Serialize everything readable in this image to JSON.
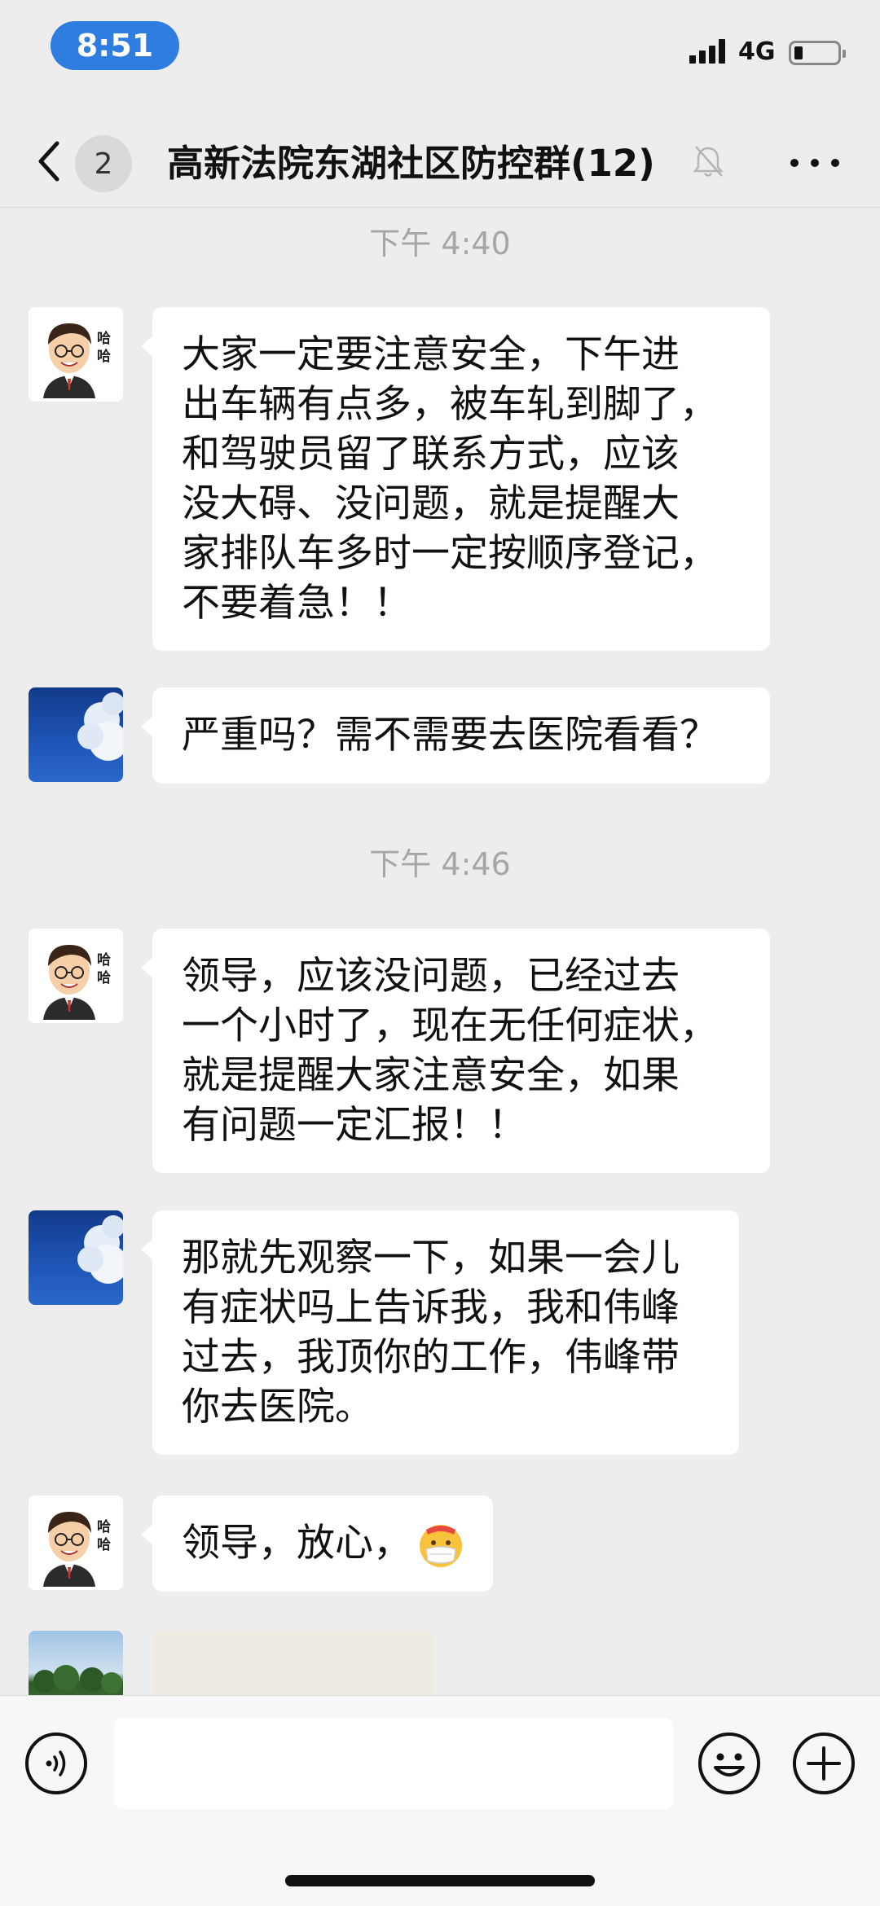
{
  "status_bar": {
    "time": "8:51",
    "network": "4G",
    "battery_level": 0.2
  },
  "nav": {
    "unread_count": "2",
    "title": "高新法院东湖社区防控群(12)",
    "icons": {
      "back": "chevron-left-icon",
      "mute": "bell-off-icon",
      "more": "more-dots-icon"
    }
  },
  "chat": {
    "timestamps": [
      "下午 4:40",
      "下午 4:46"
    ],
    "messages": [
      {
        "sender_avatar": "cartoon-man",
        "avatar_text": "哈哈",
        "text": "大家一定要注意安全，下午进\n出车辆有点多，被车轧到脚了，\n和驾驶员留了联系方式，应该\n没大碍、没问题，就是提醒大\n家排队车多时一定按顺序登记，\n不要着急！！"
      },
      {
        "sender_avatar": "sky-cloud",
        "text": "严重吗？需不需要去医院看看？"
      },
      {
        "sender_avatar": "cartoon-man",
        "avatar_text": "哈哈",
        "text": "领导，应该没问题，已经过去\n一个小时了，现在无任何症状，\n就是提醒大家注意安全，如果\n有问题一定汇报！！"
      },
      {
        "sender_avatar": "sky-cloud",
        "text": "那就先观察一下，如果一会儿\n有症状吗上告诉我，我和伟峰\n过去，我顶你的工作，伟峰带\n你去医院。"
      },
      {
        "sender_avatar": "cartoon-man",
        "avatar_text": "哈哈",
        "text": "领导，放心，",
        "emoji": "face-with-mask-emoji"
      },
      {
        "sender_avatar": "beach-trees",
        "type": "image"
      }
    ]
  },
  "input_bar": {
    "placeholder": "",
    "icons": {
      "voice": "voice-icon",
      "emoji": "smiley-icon",
      "plus": "plus-icon"
    }
  }
}
